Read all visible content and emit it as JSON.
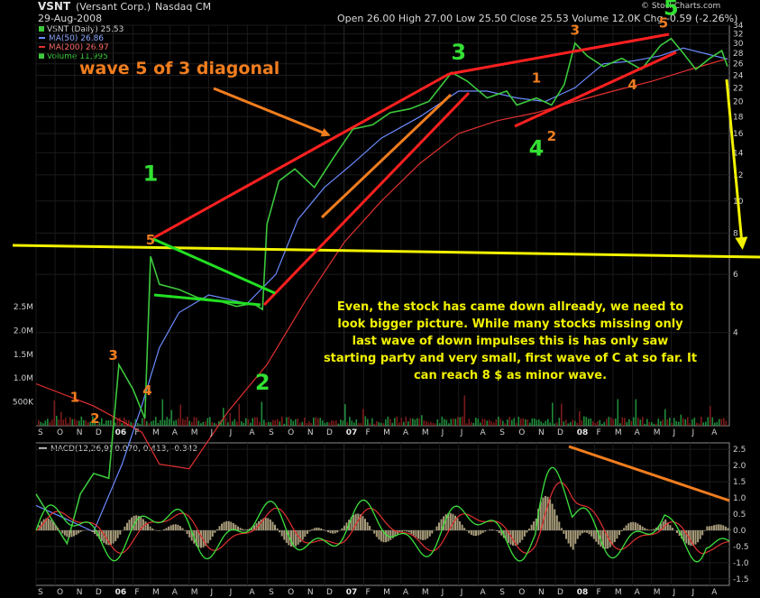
{
  "header": {
    "symbol": "VSNT",
    "company": "(Versant Corp.)",
    "exchange": "Nasdaq CM",
    "date": "29-Aug-2008",
    "quote": "Open 26.00  High 27.00  Low 25.50  Close 25.53  Volume 12.0K  Chg -0.59 (-2.26%)",
    "watermark": "© StockCharts.com"
  },
  "legend": {
    "series": "VSNT (Daily) 25.53",
    "ma50": "MA(50) 26.86",
    "ma200": "MA(200) 26.97",
    "volume": "Volume 11,995"
  },
  "macd_legend": "MACD(12,26,9) 0.070, 0.413, -0.342",
  "annotations": {
    "title_note": "wave 5 of 3 diagonal",
    "comment_lines": [
      "Even, the stock has came down allready, we need to",
      "look bigger picture. While many stocks missing only",
      "last wave of down impulses this is has only saw",
      "starting party and very small, first wave of C at so far. It",
      "can reach 8 $ as minor wave."
    ],
    "wave_labels": [
      {
        "text": "1",
        "color": "orange",
        "date": "2005-11-01",
        "price": 1.65
      },
      {
        "text": "2",
        "color": "orange",
        "date": "2005-12-03",
        "price": 0.87
      },
      {
        "text": "3",
        "color": "orange",
        "date": "2006-01-01",
        "price": 3.2
      },
      {
        "text": "4",
        "color": "orange",
        "date": "2006-02-24",
        "price": 1.9
      },
      {
        "text": "5",
        "color": "orange",
        "date": "2006-03-01",
        "price": 7.4
      },
      {
        "text": "1",
        "color": "green",
        "date": "2006-03-01",
        "price": 11.5
      },
      {
        "text": "2",
        "color": "green",
        "date": "2006-08-25",
        "price": 2.1
      },
      {
        "text": "3",
        "color": "green",
        "date": "2007-07-01",
        "price": 26.8
      },
      {
        "text": "1",
        "color": "orange",
        "date": "2007-11-01",
        "price": 22.8
      },
      {
        "text": "2",
        "color": "orange",
        "date": "2007-11-25",
        "price": 15.2
      },
      {
        "text": "3",
        "color": "orange",
        "date": "2008-01-01",
        "price": 31.8
      },
      {
        "text": "4",
        "color": "green",
        "date": "2007-11-01",
        "price": 13.7
      },
      {
        "text": "4",
        "color": "orange",
        "date": "2008-04-01",
        "price": 21.8
      },
      {
        "text": "5",
        "color": "orange",
        "date": "2008-05-20",
        "price": 33.5
      },
      {
        "text": "5",
        "color": "green",
        "date": "2008-06-01",
        "price": 36.5
      }
    ]
  },
  "chart_data": [
    {
      "type": "line",
      "title": "VSNT (Daily) 25.53",
      "ylabel": "",
      "yscale": "log",
      "ylim": [
        0.9,
        35
      ],
      "price_ticks": [
        "34",
        "32",
        "30",
        "28",
        "26",
        "24",
        "22",
        "20",
        "18",
        "16",
        "14",
        "12",
        "10",
        "8",
        "6",
        "4"
      ],
      "volume_ticks": [
        "2.5M",
        "2.0M",
        "1.5M",
        "1.0M",
        "500K"
      ],
      "x_ticks": [
        "S",
        "O",
        "N",
        "D",
        "06",
        "F",
        "M",
        "A",
        "M",
        "J",
        "J",
        "A",
        "S",
        "O",
        "N",
        "D",
        "07",
        "F",
        "M",
        "A",
        "M",
        "J",
        "J",
        "A",
        "S",
        "O",
        "N",
        "D",
        "08",
        "F",
        "M",
        "A",
        "M",
        "J",
        "J",
        "A"
      ],
      "series": [
        {
          "name": "VSNT (Daily)",
          "color": "#3cc83c",
          "points": [
            [
              "2005-09-01",
              1.3
            ],
            [
              "2005-10-01",
              1.05
            ],
            [
              "2005-10-20",
              0.92
            ],
            [
              "2005-11-10",
              1.3
            ],
            [
              "2005-12-01",
              1.5
            ],
            [
              "2005-12-25",
              1.45
            ],
            [
              "2006-01-10",
              3.2
            ],
            [
              "2006-02-01",
              2.7
            ],
            [
              "2006-02-20",
              2.2
            ],
            [
              "2006-03-01",
              6.8
            ],
            [
              "2006-03-15",
              5.6
            ],
            [
              "2006-04-15",
              5.4
            ],
            [
              "2006-05-15",
              5.1
            ],
            [
              "2006-06-15",
              5.0
            ],
            [
              "2006-07-15",
              4.8
            ],
            [
              "2006-08-10",
              4.9
            ],
            [
              "2006-08-25",
              4.7
            ],
            [
              "2006-09-01",
              8.5
            ],
            [
              "2006-09-20",
              11.5
            ],
            [
              "2006-10-15",
              12.5
            ],
            [
              "2006-11-15",
              11.0
            ],
            [
              "2006-12-15",
              13.5
            ],
            [
              "2007-01-15",
              16.5
            ],
            [
              "2007-02-15",
              17.0
            ],
            [
              "2007-03-15",
              18.5
            ],
            [
              "2007-04-15",
              19.0
            ],
            [
              "2007-05-15",
              20.0
            ],
            [
              "2007-06-20",
              24.5
            ],
            [
              "2007-07-15",
              23.0
            ],
            [
              "2007-08-15",
              20.5
            ],
            [
              "2007-09-15",
              21.5
            ],
            [
              "2007-10-01",
              19.5
            ],
            [
              "2007-11-01",
              20.5
            ],
            [
              "2007-11-25",
              19.5
            ],
            [
              "2007-12-15",
              22.5
            ],
            [
              "2008-01-01",
              30.0
            ],
            [
              "2008-01-20",
              27.5
            ],
            [
              "2008-02-15",
              25.5
            ],
            [
              "2008-03-15",
              27.0
            ],
            [
              "2008-04-15",
              25.0
            ],
            [
              "2008-05-15",
              29.5
            ],
            [
              "2008-06-01",
              31.0
            ],
            [
              "2008-06-20",
              28.0
            ],
            [
              "2008-07-10",
              25.0
            ],
            [
              "2008-08-01",
              27.0
            ],
            [
              "2008-08-20",
              28.5
            ],
            [
              "2008-08-29",
              25.53
            ]
          ]
        },
        {
          "name": "MA(50)",
          "color": "#6b8bff",
          "points": [
            [
              "2005-09-01",
              1.2
            ],
            [
              "2005-10-15",
              1.1
            ],
            [
              "2005-12-01",
              1.0
            ],
            [
              "2006-01-15",
              1.6
            ],
            [
              "2006-02-15",
              2.4
            ],
            [
              "2006-03-15",
              3.6
            ],
            [
              "2006-04-15",
              4.6
            ],
            [
              "2006-06-01",
              5.2
            ],
            [
              "2006-08-01",
              4.9
            ],
            [
              "2006-09-15",
              6.0
            ],
            [
              "2006-10-20",
              8.8
            ],
            [
              "2006-12-01",
              11.0
            ],
            [
              "2007-01-15",
              13.0
            ],
            [
              "2007-03-01",
              15.5
            ],
            [
              "2007-05-01",
              18.0
            ],
            [
              "2007-07-01",
              21.5
            ],
            [
              "2007-08-15",
              21.5
            ],
            [
              "2007-10-01",
              20.5
            ],
            [
              "2007-11-15",
              20.0
            ],
            [
              "2008-01-01",
              22.0
            ],
            [
              "2008-02-15",
              26.0
            ],
            [
              "2008-04-01",
              26.5
            ],
            [
              "2008-05-15",
              27.5
            ],
            [
              "2008-06-20",
              29.0
            ],
            [
              "2008-08-29",
              26.86
            ]
          ]
        },
        {
          "name": "MA(200)",
          "color": "#e23030",
          "points": [
            [
              "2005-09-01",
              2.8
            ],
            [
              "2005-12-01",
              2.4
            ],
            [
              "2006-02-15",
              2.0
            ],
            [
              "2006-03-15",
              1.6
            ],
            [
              "2006-05-01",
              1.55
            ],
            [
              "2006-07-01",
              2.3
            ],
            [
              "2006-09-01",
              3.2
            ],
            [
              "2006-11-01",
              5.0
            ],
            [
              "2007-01-01",
              7.5
            ],
            [
              "2007-03-01",
              10.0
            ],
            [
              "2007-05-01",
              13.0
            ],
            [
              "2007-07-01",
              16.0
            ],
            [
              "2007-09-01",
              17.5
            ],
            [
              "2007-11-01",
              18.5
            ],
            [
              "2008-01-01",
              20.0
            ],
            [
              "2008-03-01",
              21.5
            ],
            [
              "2008-05-01",
              23.0
            ],
            [
              "2008-07-01",
              25.0
            ],
            [
              "2008-08-29",
              26.97
            ]
          ]
        }
      ]
    },
    {
      "type": "line",
      "title": "MACD(12,26,9) 0.070, 0.413, -0.342",
      "ylim": [
        -1.7,
        2.7
      ],
      "ticks": [
        "2.5",
        "2.0",
        "1.5",
        "1.0",
        "0.5",
        "0.0",
        "-0.5",
        "-1.0",
        "-1.5"
      ]
    }
  ],
  "colors": {
    "background": "#000000",
    "panel_border": "#8a8a8a",
    "red_trend": "#ff2020",
    "green_trend": "#22e022",
    "orange_trend": "#f07d1e",
    "yellow": "#f2f200"
  }
}
